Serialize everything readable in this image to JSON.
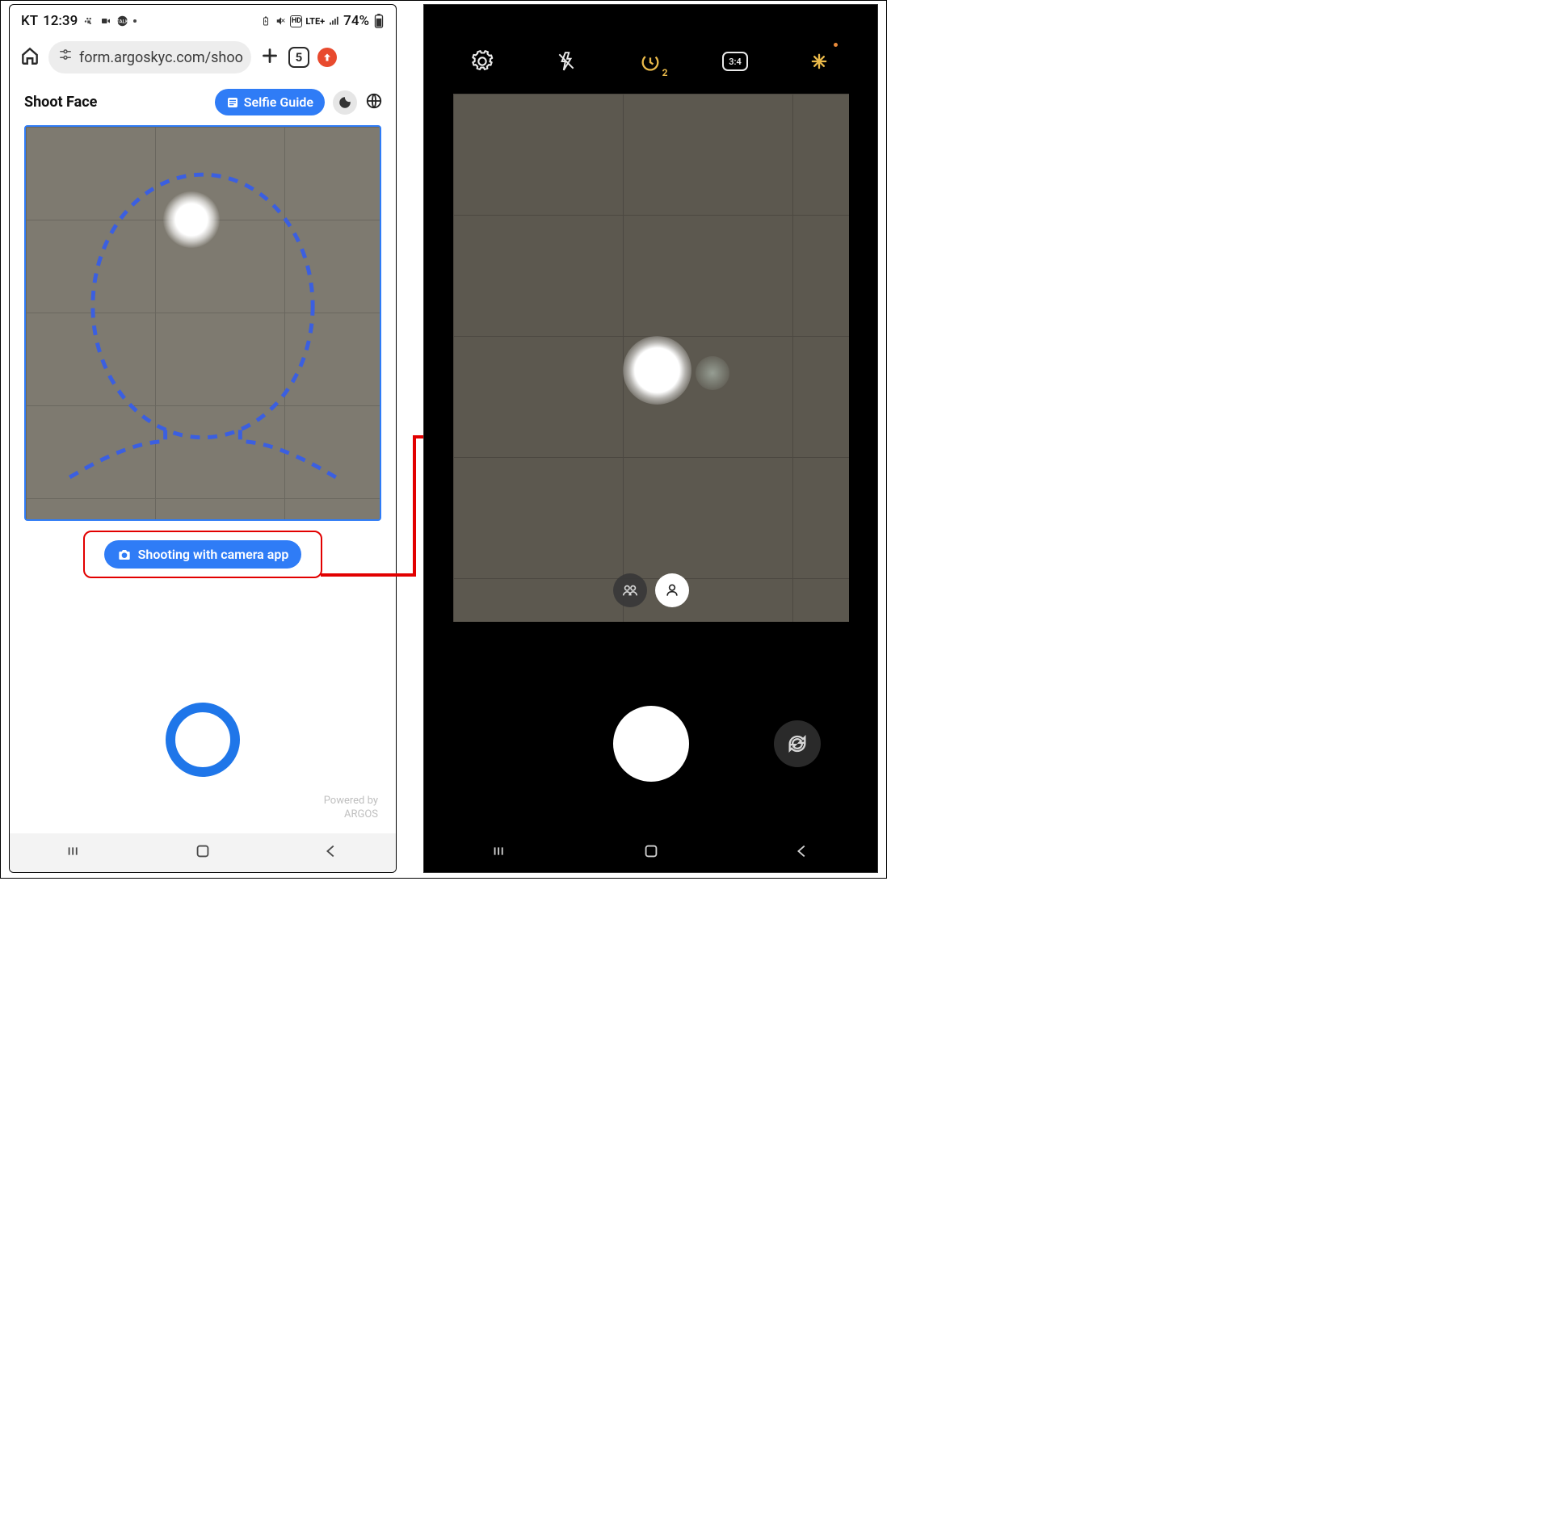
{
  "left_phone": {
    "status": {
      "carrier": "KT",
      "time": "12:39",
      "battery": "74%",
      "network": "LTE+",
      "icons": {
        "hd": "HD",
        "mute": "mute-icon",
        "signal": "signal-icon",
        "battery_low": "battery-saver-icon"
      }
    },
    "browser": {
      "url": "form.argoskyc.com/shoo",
      "tab_count": "5"
    },
    "app": {
      "title": "Shoot Face",
      "selfie_guide": "Selfie Guide",
      "action_button": "Shooting with camera app",
      "powered_line1": "Powered by",
      "powered_line2": "ARGOS"
    }
  },
  "right_phone": {
    "camera": {
      "timer_badge": "2",
      "ratio": "3:4",
      "icons": {
        "settings": "gear-icon",
        "flash": "flash-off-icon",
        "timer": "timer-icon",
        "ratio": "aspect-ratio-icon",
        "wand": "magic-wand-icon"
      },
      "toggle": {
        "group": "group-icon",
        "single": "person-icon"
      }
    }
  },
  "nav": {
    "recents": "recents-icon",
    "home": "home-icon",
    "back": "back-icon"
  },
  "annotation": {
    "arrow": "arrow-from-button-to-camera"
  }
}
